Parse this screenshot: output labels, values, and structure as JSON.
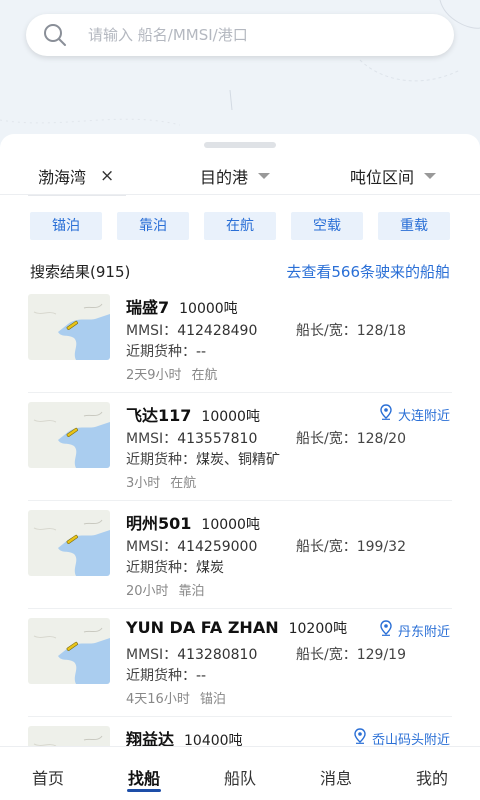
{
  "search": {
    "placeholder": "请输入 船名/MMSI/港口"
  },
  "filters": {
    "region": "渤海湾",
    "region_close": "×",
    "destination": "目的港",
    "tonnage": "吨位区间"
  },
  "chips": [
    "锚泊",
    "靠泊",
    "在航",
    "空载",
    "重载"
  ],
  "results": {
    "title": "搜索结果(915)",
    "link": "去查看566条驶来的船舶"
  },
  "labels": {
    "mmsi": "MMSI：",
    "dims": "船长/宽：",
    "cargo": "近期货种："
  },
  "ships": [
    {
      "name": "瑞盛7",
      "tons": "10000吨",
      "mmsi": "412428490",
      "dims": "128/18",
      "cargo": "--",
      "time": "2天9小时",
      "status": "在航",
      "location": ""
    },
    {
      "name": "飞达117",
      "tons": "10000吨",
      "mmsi": "413557810",
      "dims": "128/20",
      "cargo": "煤炭、铜精矿",
      "time": "3小时",
      "status": "在航",
      "location": "大连附近"
    },
    {
      "name": "明州501",
      "tons": "10000吨",
      "mmsi": "414259000",
      "dims": "199/32",
      "cargo": "煤炭",
      "time": "20小时",
      "status": "靠泊",
      "location": ""
    },
    {
      "name": "YUN DA FA ZHAN",
      "tons": "10200吨",
      "mmsi": "413280810",
      "dims": "129/19",
      "cargo": "--",
      "time": "4天16小时",
      "status": "锚泊",
      "location": "丹东附近"
    },
    {
      "name": "翔益达",
      "tons": "10400吨",
      "mmsi": "",
      "dims": "",
      "cargo": "",
      "time": "",
      "status": "",
      "location": "岙山码头附近"
    }
  ],
  "tabs": [
    "首页",
    "找船",
    "船队",
    "消息",
    "我的"
  ],
  "colors": {
    "accent": "#2a6fd6",
    "chip_bg": "#e9f1fb",
    "tab_active": "#1d4ea8",
    "sea": "#aacdef"
  },
  "icons": {
    "search": "search-icon",
    "close": "close-icon",
    "caret": "caret-down-icon",
    "pin": "location-pin-icon"
  }
}
